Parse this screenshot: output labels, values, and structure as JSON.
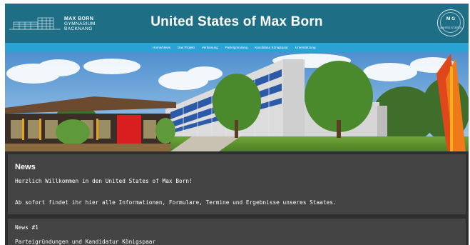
{
  "header": {
    "logo_line1": "MAX BORN",
    "logo_line2": "GYMNASIUM",
    "logo_line3": "BACKNANG",
    "title": "United States of Max Born",
    "seal_mark": "M G",
    "seal_text": "UNITED STATES"
  },
  "nav": {
    "items": [
      {
        "label": "Home/News"
      },
      {
        "label": "Das Projekt"
      },
      {
        "label": "Verfassung"
      },
      {
        "label": "Parteigründung"
      },
      {
        "label": "Kandidatur Königspaar"
      },
      {
        "label": "Unterstützung"
      }
    ]
  },
  "news": {
    "heading": "News",
    "line1": "Herzlich Willkommen in den United States of Max Born!",
    "line2": "Ab sofort findet ihr hier alle Informationen, Formulare, Termine und Ergebnisse unseres Staates."
  },
  "news_item": {
    "title": "News #1",
    "text": "Parteigründungen und Kandidatur Königspaar"
  },
  "colors": {
    "header_bg": "#1e6e86",
    "nav_bg": "#2aa3d4",
    "content_bg": "#2f2f2f",
    "box_bg": "#444444"
  }
}
